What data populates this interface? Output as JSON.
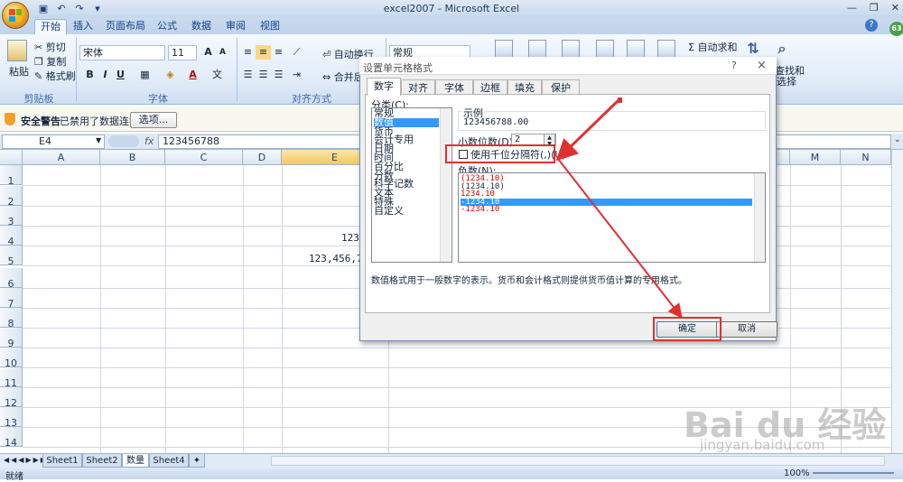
{
  "window": {
    "title": "excel2007 - Microsoft Excel"
  },
  "tabs": [
    "开始",
    "插入",
    "页面布局",
    "公式",
    "数据",
    "审阅",
    "视图"
  ],
  "ribbon": {
    "clipboard": {
      "paste": "粘贴",
      "cut": "剪切",
      "copy": "复制",
      "format_painter": "格式刷",
      "label": "剪贴板"
    },
    "font": {
      "name": "宋体",
      "size": "11",
      "label": "字体"
    },
    "alignment": {
      "wrap": "自动换行",
      "merge": "合并后居中",
      "label": "对齐方式"
    },
    "number": {
      "format": "常规"
    },
    "editing": {
      "autosum": "Σ 自动求和",
      "find": "查找和",
      "select": "选择"
    }
  },
  "security": {
    "title": "安全警告",
    "message": "已禁用了数据连接",
    "options": "选项..."
  },
  "formula_bar": {
    "name_box": "E4",
    "fx": "fx",
    "value": "123456788"
  },
  "columns": [
    "A",
    "B",
    "C",
    "D",
    "E",
    "M",
    "N"
  ],
  "rows": [
    "1",
    "2",
    "3",
    "4",
    "5",
    "6",
    "7",
    "8",
    "9",
    "10",
    "11",
    "12",
    "13",
    "14"
  ],
  "cells": {
    "e4": "1234",
    "e5": "123,456,78"
  },
  "sheets": [
    "Sheet1",
    "Sheet2",
    "数量",
    "Sheet4"
  ],
  "status": {
    "ready": "就绪",
    "zoom": "100%"
  },
  "dialog": {
    "title": "设置单元格格式",
    "help": "?",
    "close": "×",
    "tabs": [
      "数字",
      "对齐",
      "字体",
      "边框",
      "填充",
      "保护"
    ],
    "category_label": "分类(C):",
    "categories": [
      "常规",
      "数值",
      "货币",
      "会计专用",
      "日期",
      "时间",
      "百分比",
      "分数",
      "科学记数",
      "文本",
      "特殊",
      "自定义"
    ],
    "sample_label": "示例",
    "sample_value": "123456788.00",
    "decimal_label": "小数位数(D):",
    "decimal_value": "2",
    "thousands_label": "使用千位分隔符(,)(U)",
    "negative_label": "负数(N):",
    "negatives": [
      "(1234.10)",
      "(1234.10)",
      "1234.10",
      "-1234.10",
      "-1234.10"
    ],
    "description": "数值格式用于一般数字的表示。货币和会计格式则提供货币值计算的专用格式。",
    "ok": "确定",
    "cancel": "取消"
  },
  "watermark": {
    "brand": "Bai du 经验",
    "url": "jingyan.baidu.com"
  },
  "colors": {
    "accent": "#3399ff",
    "annotation": "#e03030",
    "negative_red": "#e00000"
  }
}
